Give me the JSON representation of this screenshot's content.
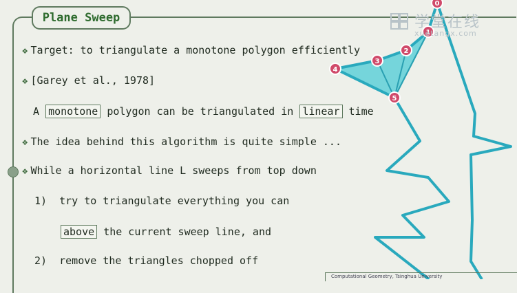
{
  "slide": {
    "title": "Plane Sweep",
    "lines": {
      "target": "Target: to triangulate a monotone polygon efficiently",
      "citation": "[Garey et al., 1978]",
      "claim_a": "A",
      "claim_boxed1": "monotone",
      "claim_mid": "polygon can be triangulated in",
      "claim_boxed2": "linear",
      "claim_end": "time",
      "idea": "The idea behind this algorithm is quite simple ...",
      "sweep": "While a horizontal line L sweeps from top down",
      "step1_num": "1)",
      "step1": "try to triangulate everything you can",
      "step1b_boxed": "above",
      "step1b": "the current sweep line, and",
      "step2_num": "2)",
      "step2": "remove the triangles chopped off"
    },
    "bullet_symbol": "❖",
    "footer": "Computational Geometry, Tsinghua University"
  },
  "vertex_labels": [
    "0",
    "1",
    "2",
    "3",
    "4",
    "5"
  ],
  "watermark": {
    "cn": "学堂在线",
    "en": "xuetangx.com"
  },
  "colors": {
    "accent": "#2e6b2e",
    "polygon": "#29a9bd",
    "triangle_fill": "#5fd0d8",
    "vertex": "#d04a6a"
  }
}
